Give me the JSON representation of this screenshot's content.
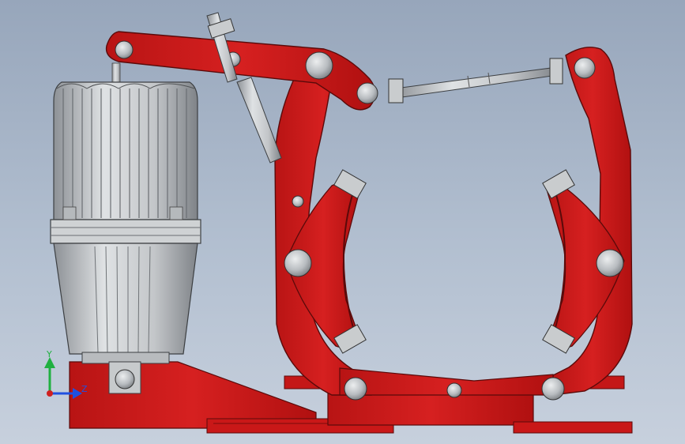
{
  "viewport": {
    "background_top": "#97a6bb",
    "background_bottom": "#c7d0dd",
    "model_color": "#cc1a1a",
    "model_edge_color": "#5a0a0a",
    "metal_color": "#c6c9cc"
  },
  "triad": {
    "y_label": "Y",
    "z_label": "Z",
    "y_color": "#20b040",
    "z_color": "#2050e0",
    "x_color": "#d02020"
  }
}
